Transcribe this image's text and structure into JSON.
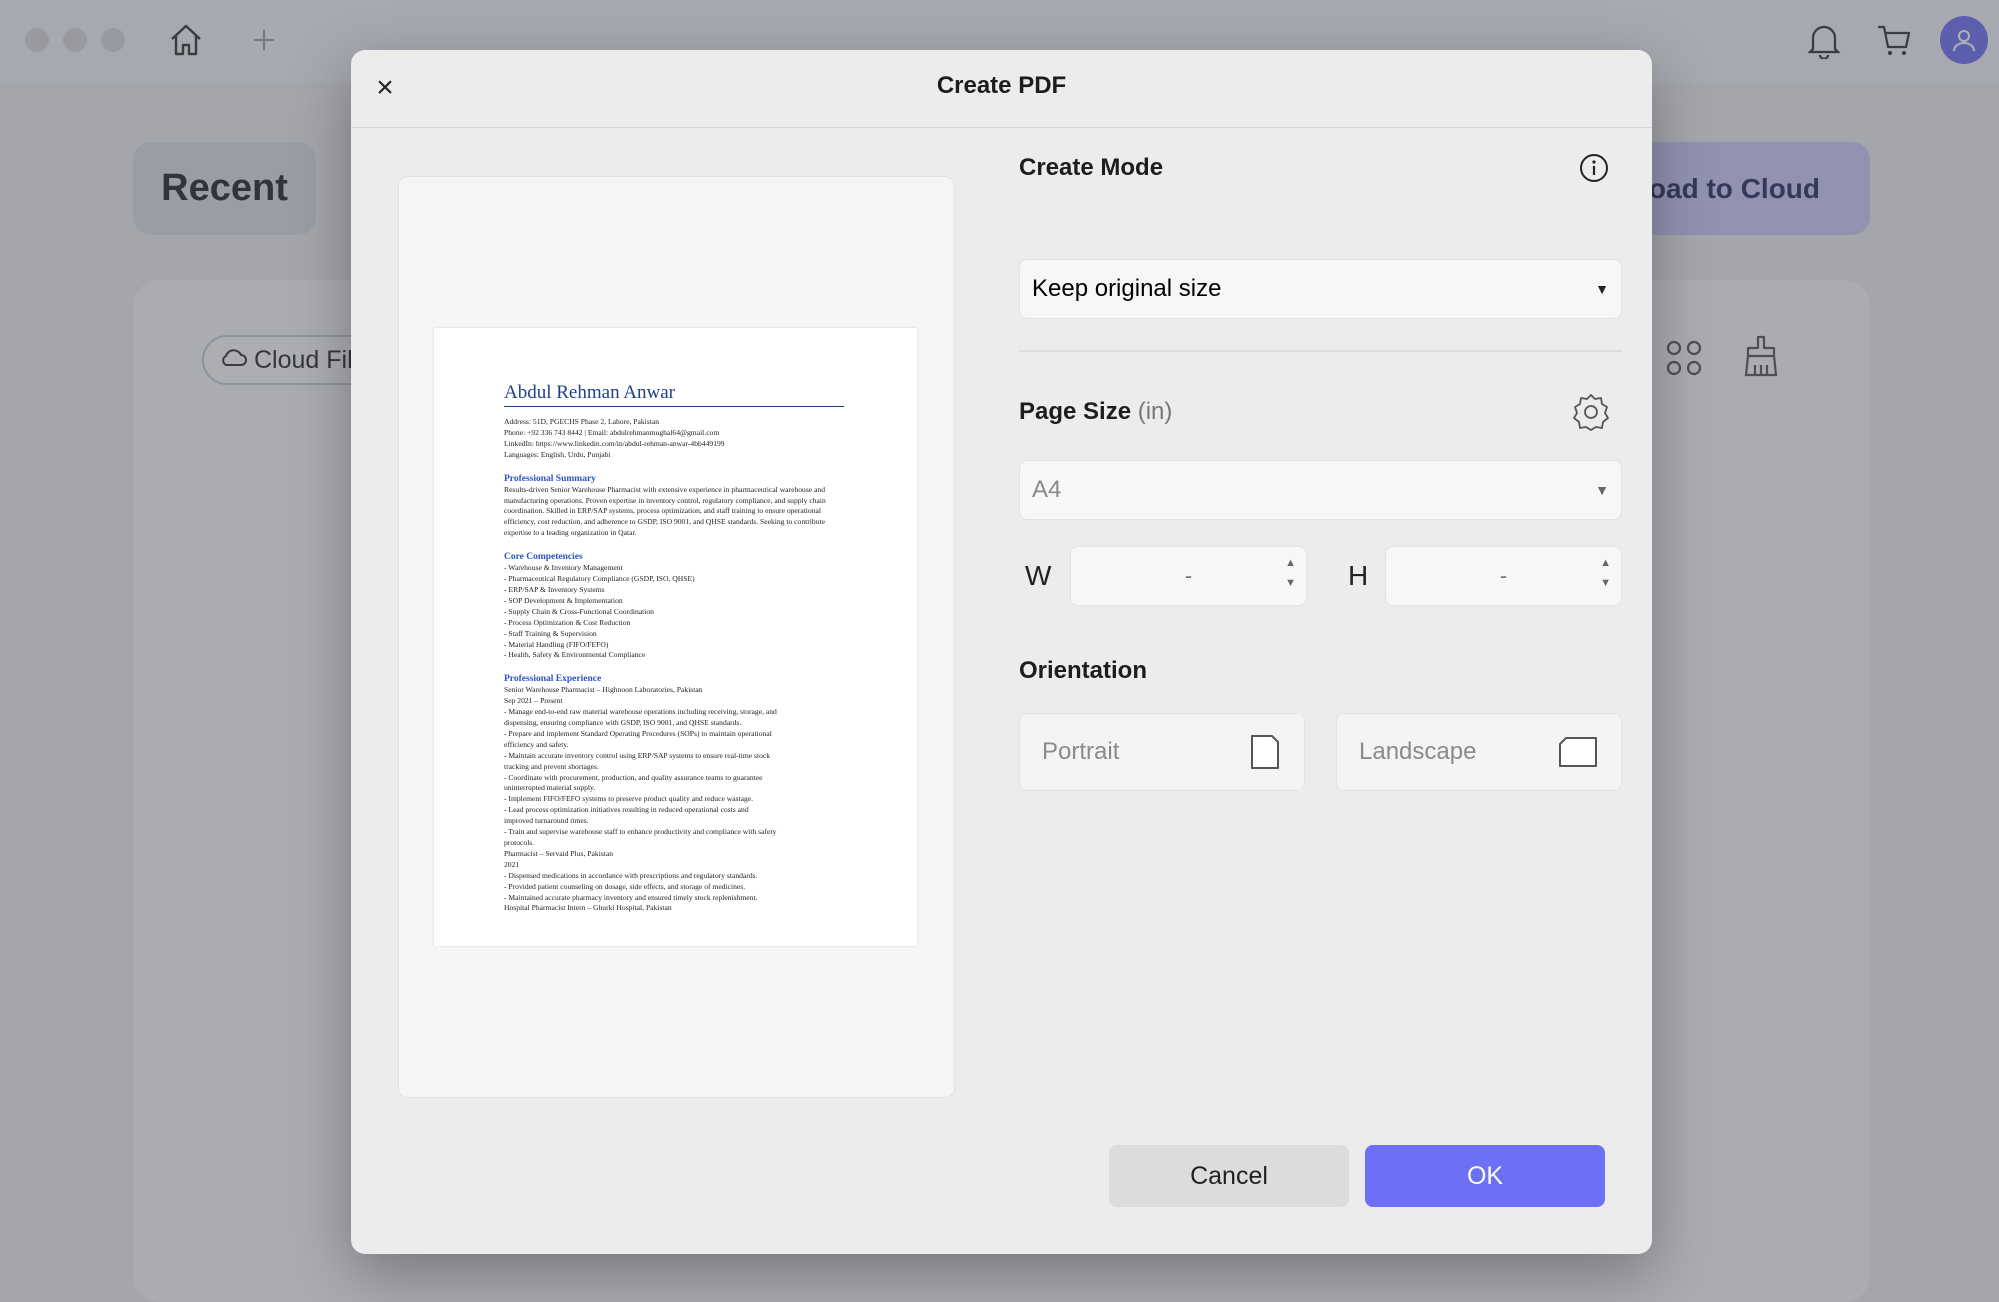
{
  "app": {
    "recent_label": "Recent",
    "upload_label": "oad to Cloud",
    "cloud_pill_label": "Cloud File",
    "accent": "#6b70f5"
  },
  "dialog": {
    "title": "Create PDF",
    "close_glyph": "×",
    "create_mode": {
      "label": "Create Mode",
      "value": "Keep original size"
    },
    "page_size": {
      "label": "Page Size",
      "unit": "(in)",
      "value": "A4"
    },
    "width": {
      "label": "W",
      "value": "-"
    },
    "height": {
      "label": "H",
      "value": "-"
    },
    "orientation": {
      "label": "Orientation",
      "portrait": "Portrait",
      "landscape": "Landscape"
    },
    "cancel_label": "Cancel",
    "ok_label": "OK"
  },
  "preview": {
    "name": "Abdul Rehman Anwar",
    "contact": [
      "Address: 51D, PGECHS Phase 2, Lahore, Pakistan",
      "Phone: +92 336 743 8442 | Email: abdulrehmanmughal64@gmail.com",
      "LinkedIn: https://www.linkedin.com/in/abdul-rehman-anwar-4bb449199",
      "Languages: English, Urdu, Punjabi"
    ],
    "summary_title": "Professional Summary",
    "summary": "Results-driven Senior Warehouse Pharmacist with extensive experience in pharmaceutical warehouse and manufacturing operations. Proven expertise in inventory control, regulatory compliance, and supply chain coordination. Skilled in ERP/SAP systems, process optimization, and staff training to ensure operational efficiency, cost reduction, and adherence to GSDP, ISO 9001, and QHSE standards. Seeking to contribute expertise to a leading organization in Qatar.",
    "competencies_title": "Core Competencies",
    "competencies": [
      "- Warehouse & Inventory Management",
      "- Pharmaceutical Regulatory Compliance (GSDP, ISO, QHSE)",
      "- ERP/SAP & Inventory Systems",
      "- SOP Development & Implementation",
      "- Supply Chain & Cross-Functional Coordination",
      "- Process Optimization & Cost Reduction",
      "- Staff Training & Supervision",
      "- Material Handling (FIFO/FEFO)",
      "- Health, Safety & Environmental Compliance"
    ],
    "experience_title": "Professional Experience",
    "experience": [
      "Senior Warehouse Pharmacist – Highnoon Laboratories, Pakistan",
      "Sep 2021 – Present",
      "- Manage end-to-end raw material warehouse operations including receiving, storage, and",
      "dispensing, ensuring compliance with GSDP, ISO 9001, and QHSE standards.",
      "- Prepare and implement Standard Operating Procedures (SOPs) to maintain operational",
      "efficiency and safety.",
      "- Maintain accurate inventory control using ERP/SAP systems to ensure real-time stock",
      "tracking and prevent shortages.",
      "- Coordinate with procurement, production, and quality assurance teams to guarantee",
      "uninterrupted material supply.",
      "- Implement FIFO/FEFO systems to preserve product quality and reduce wastage.",
      "- Lead process optimization initiatives resulting in reduced operational costs and",
      "improved turnaround times.",
      "- Train and supervise warehouse staff to enhance productivity and compliance with safety",
      "protocols.",
      "Pharmacist – Servaid Plus, Pakistan",
      "2021",
      "- Dispensed medications in accordance with prescriptions and regulatory standards.",
      "- Provided patient counseling on dosage, side effects, and storage of medicines.",
      "- Maintained accurate pharmacy inventory and ensured timely stock replenishment.",
      "Hospital Pharmacist Intern – Ghurki Hospital, Pakistan"
    ]
  }
}
